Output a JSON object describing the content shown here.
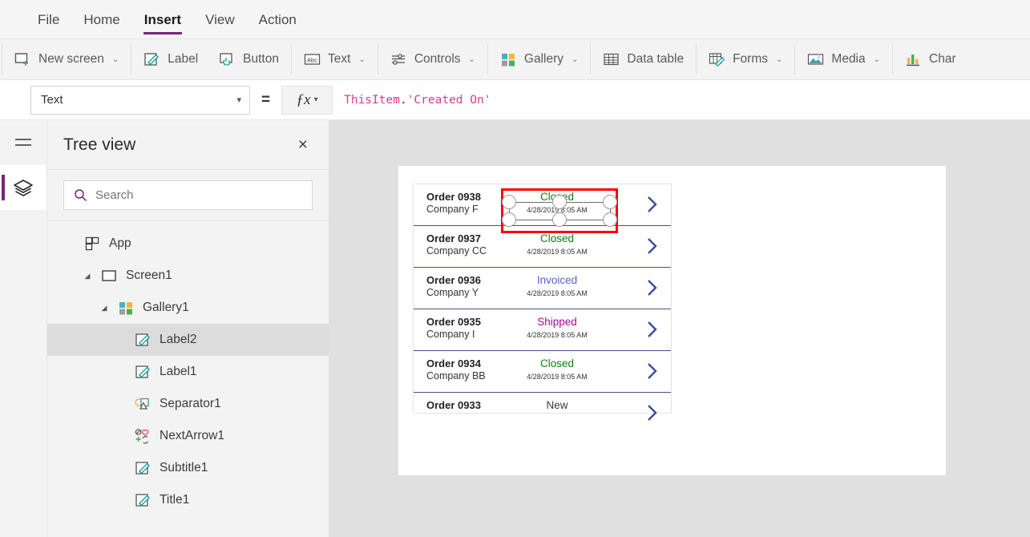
{
  "menubar": {
    "items": [
      {
        "label": "File",
        "active": false
      },
      {
        "label": "Home",
        "active": false
      },
      {
        "label": "Insert",
        "active": true
      },
      {
        "label": "View",
        "active": false
      },
      {
        "label": "Action",
        "active": false
      }
    ]
  },
  "ribbon": {
    "items": [
      {
        "label": "New screen",
        "icon": "new-screen-icon",
        "caret": true
      },
      {
        "label": "Label",
        "icon": "label-icon",
        "caret": false
      },
      {
        "label": "Button",
        "icon": "button-icon",
        "caret": false
      },
      {
        "label": "Text",
        "icon": "text-abc-icon",
        "caret": true
      },
      {
        "label": "Controls",
        "icon": "controls-sliders-icon",
        "caret": true
      },
      {
        "label": "Gallery",
        "icon": "gallery-icon",
        "caret": true
      },
      {
        "label": "Data table",
        "icon": "data-table-icon",
        "caret": false
      },
      {
        "label": "Forms",
        "icon": "forms-icon",
        "caret": true
      },
      {
        "label": "Media",
        "icon": "media-image-icon",
        "caret": true
      },
      {
        "label": "Char",
        "icon": "charts-icon",
        "caret": false
      }
    ]
  },
  "formula_bar": {
    "property": "Text",
    "equals": "=",
    "fx_label": "ƒx",
    "formula_ident": "ThisItem",
    "formula_dot": ".",
    "formula_string": "'Created On'"
  },
  "rail": {
    "hamburger": "hamburger-menu-icon",
    "active_tool": "tree-view-layers-icon"
  },
  "treeview": {
    "title": "Tree view",
    "close": "×",
    "search_placeholder": "Search",
    "search_value": "",
    "items": [
      {
        "label": "App",
        "icon": "app-icon",
        "indent": 0,
        "twisty": "",
        "selected": false
      },
      {
        "label": "Screen1",
        "icon": "screen-icon",
        "indent": 1,
        "twisty": "◢",
        "selected": false
      },
      {
        "label": "Gallery1",
        "icon": "gallery-icon",
        "indent": 2,
        "twisty": "◢",
        "selected": false
      },
      {
        "label": "Label2",
        "icon": "label-icon",
        "indent": 3,
        "twisty": "",
        "selected": true
      },
      {
        "label": "Label1",
        "icon": "label-icon",
        "indent": 3,
        "twisty": "",
        "selected": false
      },
      {
        "label": "Separator1",
        "icon": "separator-icon",
        "indent": 3,
        "twisty": "",
        "selected": false
      },
      {
        "label": "NextArrow1",
        "icon": "next-arrow-icon",
        "indent": 3,
        "twisty": "",
        "selected": false
      },
      {
        "label": "Subtitle1",
        "icon": "label-icon",
        "indent": 3,
        "twisty": "",
        "selected": false
      },
      {
        "label": "Title1",
        "icon": "label-icon",
        "indent": 3,
        "twisty": "",
        "selected": false
      }
    ]
  },
  "canvas": {
    "gallery": {
      "rows": [
        {
          "title": "Order 0938",
          "subtitle": "Company F",
          "status": "Closed",
          "status_color": "#107c10",
          "date": "4/28/2019 8:05 AM",
          "partial": false
        },
        {
          "title": "Order 0937",
          "subtitle": "Company CC",
          "status": "Closed",
          "status_color": "#107c10",
          "date": "4/28/2019 8:05 AM",
          "partial": false
        },
        {
          "title": "Order 0936",
          "subtitle": "Company Y",
          "status": "Invoiced",
          "status_color": "#5b5bd6",
          "date": "4/28/2019 8:05 AM",
          "partial": false
        },
        {
          "title": "Order 0935",
          "subtitle": "Company I",
          "status": "Shipped",
          "status_color": "#b4009e",
          "date": "4/28/2019 8:05 AM",
          "partial": false
        },
        {
          "title": "Order 0934",
          "subtitle": "Company BB",
          "status": "Closed",
          "status_color": "#107c10",
          "date": "4/28/2019 8:05 AM",
          "partial": false
        },
        {
          "title": "Order 0933",
          "subtitle": "",
          "status": "New",
          "status_color": "#3b3b3b",
          "date": "",
          "partial": true
        }
      ],
      "arrow_color": "#3b4ba0",
      "divider_color": "#47508c"
    },
    "selection": {
      "outline_color": "#ff0000",
      "handle_fill": "#ffffff",
      "handle_stroke": "#9a9a9a"
    }
  },
  "colors": {
    "accent": "#742774",
    "menubar_bg": "#f5f5f5",
    "ribbon_bg": "#f3f3f3",
    "panel_bg": "#f3f3f3",
    "canvas_bg": "#e0e0e0",
    "selected_row_bg": "#dcdcdc"
  }
}
